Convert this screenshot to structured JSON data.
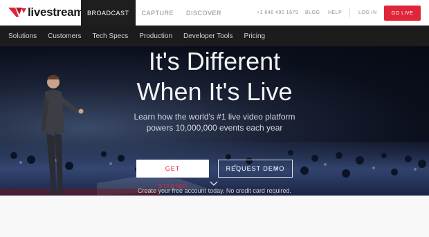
{
  "brand": {
    "name": "livestream",
    "accent": "#e0253a"
  },
  "primary_nav": [
    {
      "label": "BROADCAST",
      "active": true
    },
    {
      "label": "CAPTURE",
      "active": false
    },
    {
      "label": "DISCOVER",
      "active": false
    }
  ],
  "utility_nav": {
    "phone": "+1 646 490 1679",
    "blog": "BLOG",
    "help": "HELP",
    "login": "LOG IN",
    "go_live": "GO LIVE"
  },
  "sub_nav": [
    "Solutions",
    "Customers",
    "Tech Specs",
    "Production",
    "Developer Tools",
    "Pricing"
  ],
  "hero": {
    "title_line1": "It's Different",
    "title_line2": "When It's Live",
    "subtitle_line1": "Learn how the world's #1 live video platform",
    "subtitle_line2": "powers 10,000,000 events each year",
    "get_button": "GET",
    "get_button_sub": "STARTED",
    "demo_button": "REQUEST DEMO",
    "note": "Create your free account today. No credit card required.",
    "scroll_icon": "chevron-down-icon"
  }
}
